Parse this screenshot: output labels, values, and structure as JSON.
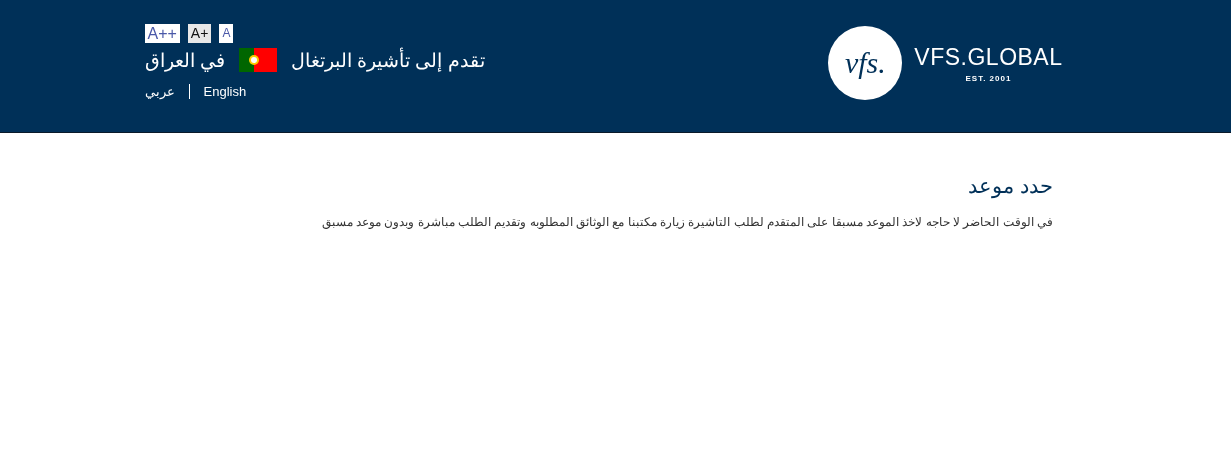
{
  "header": {
    "font_sizes": [
      {
        "label": "A",
        "selected": false
      },
      {
        "label": "A+",
        "selected": true
      },
      {
        "label": "A++",
        "selected": false
      }
    ],
    "title_start": "تقدم إلى تأشيرة البرتغال",
    "title_end": "في العراق",
    "languages": [
      {
        "label": "English"
      },
      {
        "label": "عربي"
      }
    ],
    "logo": {
      "mark": "vfs.",
      "name": "VFS.GLOBAL",
      "tagline": "EST. 2001"
    }
  },
  "main": {
    "heading": "حدد موعد",
    "text": "في الوقت الحاضر لا حاجه لاخذ الموعد مسبقا على المتقدم لطلب التاشيرة زيارة مكتبنا مع الوثائق المطلوبه وتقديم الطلب مباشرة وبدون موعد مسبق"
  }
}
